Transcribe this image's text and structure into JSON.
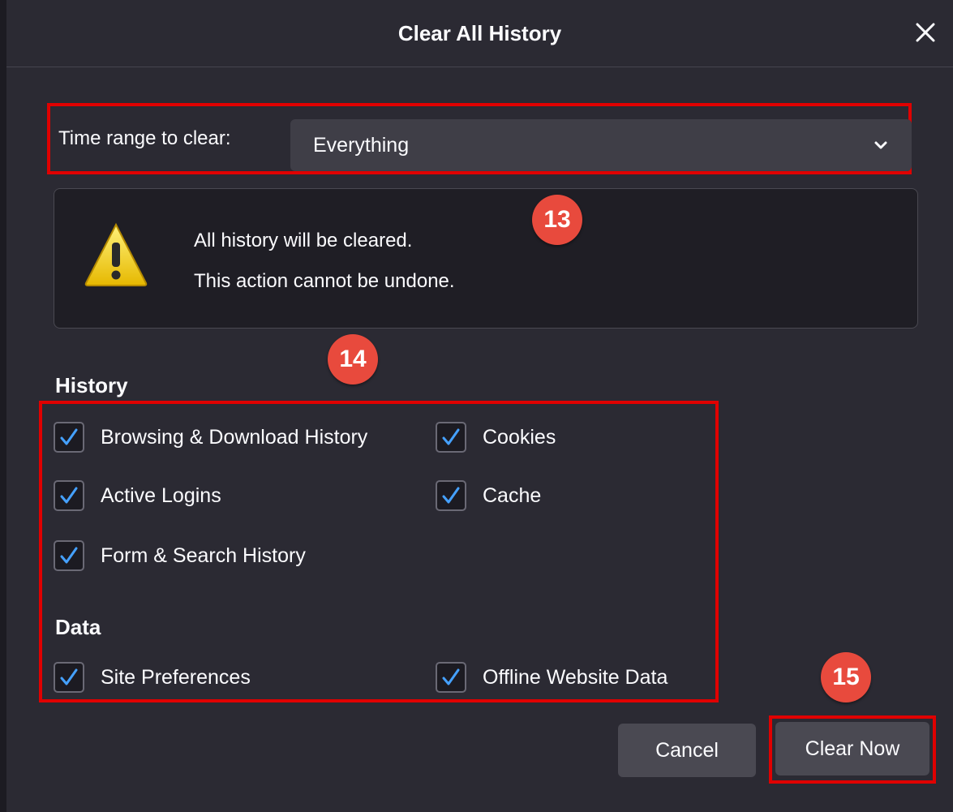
{
  "dialog": {
    "title": "Clear All History",
    "close_icon": "close-icon"
  },
  "time_range": {
    "label": "Time range to clear:",
    "selected": "Everything"
  },
  "warning": {
    "icon": "warning-icon",
    "line1": "All history will be cleared.",
    "line2": "This action cannot be undone."
  },
  "markers": {
    "m13": "13",
    "m14": "14",
    "m15": "15"
  },
  "history": {
    "heading": "History",
    "items": [
      {
        "label": "Browsing & Download History",
        "checked": true
      },
      {
        "label": "Cookies",
        "checked": true
      },
      {
        "label": "Active Logins",
        "checked": true
      },
      {
        "label": "Cache",
        "checked": true
      },
      {
        "label": "Form & Search History",
        "checked": true
      }
    ]
  },
  "data_section": {
    "heading": "Data",
    "items": [
      {
        "label": "Site Preferences",
        "checked": true
      },
      {
        "label": "Offline Website Data",
        "checked": true
      }
    ]
  },
  "buttons": {
    "cancel": "Cancel",
    "clear_now": "Clear Now"
  },
  "colors": {
    "background": "#2b2a33",
    "highlight": "#e00000",
    "marker": "#e84a3d",
    "checkmark": "#45a1ff"
  }
}
